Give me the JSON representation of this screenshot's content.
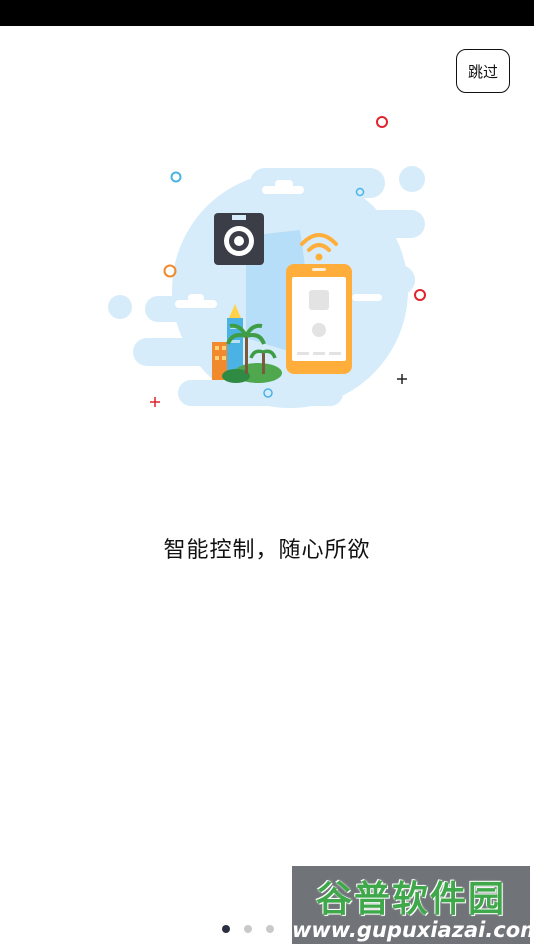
{
  "header": {
    "skip_label": "跳过"
  },
  "main": {
    "headline": "智能控制，随心所欲"
  },
  "pager": {
    "count": 3,
    "active_index": 0
  },
  "watermark": {
    "title": "谷普软件园",
    "url": "www.gupuxiazai.com"
  },
  "colors": {
    "cloud": "#d6ecfa",
    "phone": "#ffae3b",
    "camera": "#3c3e47",
    "accent_red": "#e0232c",
    "accent_blue": "#4bb3e4",
    "accent_orange": "#f08a2c"
  }
}
